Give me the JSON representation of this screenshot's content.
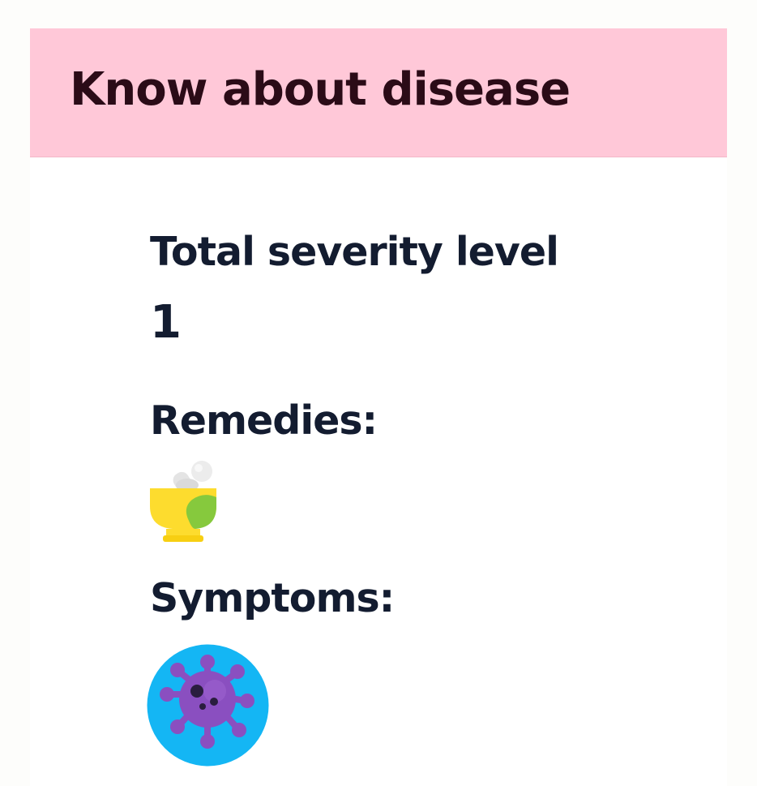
{
  "header": {
    "title": "Know about disease",
    "background_color": "#ffc8d8"
  },
  "severity": {
    "label": "Total severity level",
    "value": "1"
  },
  "remedies": {
    "label": "Remedies:",
    "icon": "mortar-pestle-icon"
  },
  "symptoms": {
    "label": "Symptoms:",
    "icon": "virus-icon",
    "icon_background_color": "#14b6f4"
  }
}
